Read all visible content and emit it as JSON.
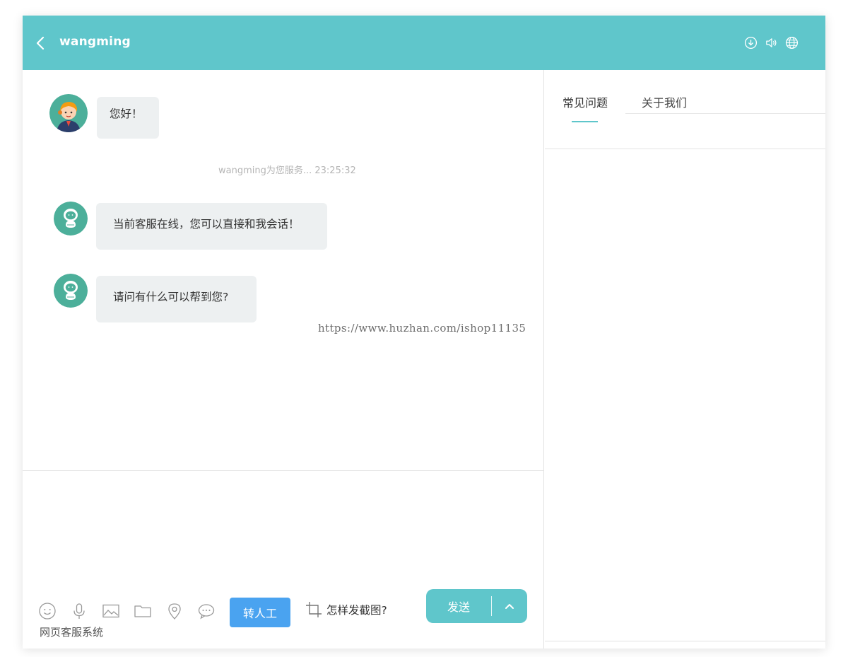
{
  "header": {
    "title": "wangming",
    "back_icon": "chevron-left-icon",
    "icons": [
      "download-circle-icon",
      "speaker-icon",
      "globe-icon"
    ],
    "color": "#5fc6cb"
  },
  "chat": {
    "messages": [
      {
        "sender": "agent",
        "avatar": "agent-avatar",
        "text": "您好！"
      },
      {
        "sender": "bot",
        "avatar": "robot-avatar",
        "text": "当前客服在线，您可以直接和我会话！"
      },
      {
        "sender": "bot",
        "avatar": "robot-avatar",
        "text": "请问有什么可以帮到您?"
      }
    ],
    "system_note": "wangming为您服务... 23:25:32",
    "watermark": "https://www.huzhan.com/ishop11135"
  },
  "toolbar": {
    "tools": [
      "emoji-icon",
      "microphone-icon",
      "image-icon",
      "folder-icon",
      "location-icon",
      "comment-icon"
    ],
    "transfer_label": "转人工",
    "screenshot_help": "怎样发截图?",
    "send_label": "发送",
    "send_more_icon": "chevron-up-icon",
    "footer_label": "网页客服系统",
    "accent_blue": "#4aa3f0"
  },
  "side": {
    "tabs": [
      {
        "label": "常见问题",
        "active": true
      },
      {
        "label": "关于我们",
        "active": false
      }
    ]
  }
}
